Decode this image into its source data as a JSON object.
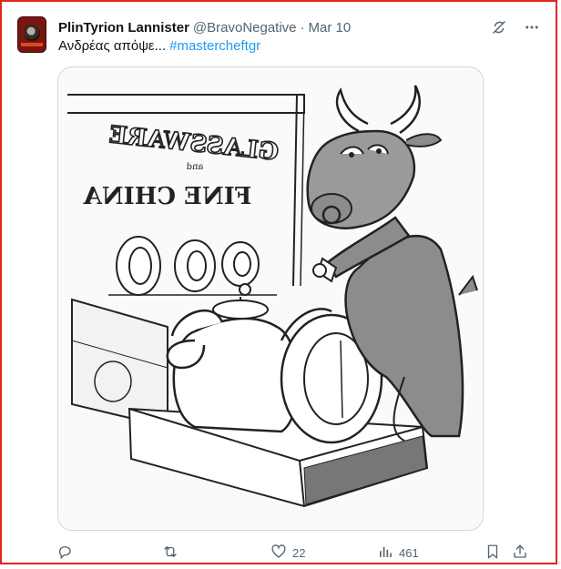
{
  "tweet": {
    "display_name": "PlinTyrion Lannister",
    "handle": "@BravoNegative",
    "separator": "·",
    "date": "Mar 10",
    "text": "Ανδρέας απόψε...",
    "hashtag": "#mastercheftgr",
    "image_sign_line1": "GLASSWARE",
    "image_sign_line2": "FINE CHINA",
    "image_sign_connector": "and"
  },
  "actions": {
    "replies_count": "",
    "retweets_count": "",
    "likes_count": "22",
    "views_count": "461"
  },
  "icons": {
    "grok": "grok-icon",
    "more": "more-icon",
    "reply": "reply-icon",
    "retweet": "retweet-icon",
    "like": "heart-icon",
    "views": "views-icon",
    "bookmark": "bookmark-icon",
    "share": "share-icon"
  },
  "colors": {
    "accent": "#1d9bf0",
    "frame": "#e0251b",
    "muted": "#536471"
  }
}
